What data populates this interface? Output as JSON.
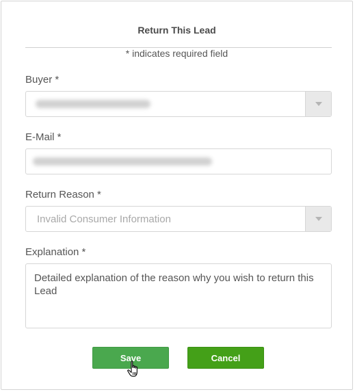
{
  "dialog": {
    "title": "Return This Lead",
    "required_note": "* indicates required field"
  },
  "form": {
    "buyer": {
      "label": "Buyer *",
      "value_redacted": true
    },
    "email": {
      "label": "E-Mail *",
      "value_redacted": true
    },
    "return_reason": {
      "label": "Return Reason *",
      "placeholder": "Invalid Consumer Information"
    },
    "explanation": {
      "label": "Explanation *",
      "placeholder": "Detailed explanation of the reason why you wish to return this Lead"
    }
  },
  "buttons": {
    "save_label": "Save",
    "cancel_label": "Cancel"
  },
  "icons": {
    "dropdown": "chevron-down-icon",
    "cursor": "hand-pointer-icon"
  },
  "colors": {
    "save": "#4aa84e",
    "cancel": "#44a018"
  }
}
